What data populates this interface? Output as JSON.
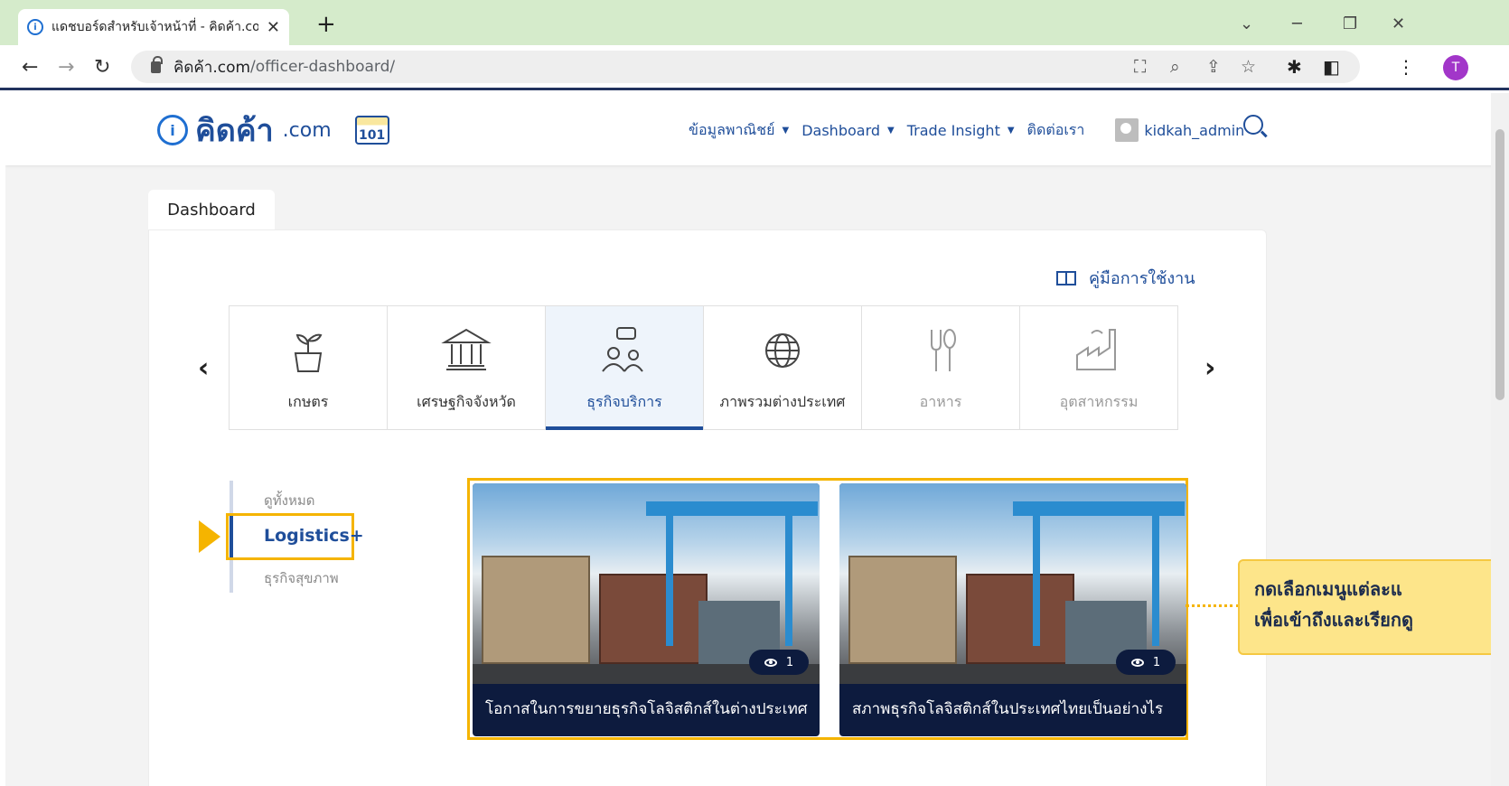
{
  "browser": {
    "tab_title": "แดชบอร์ดสำหรับเจ้าหน้าที่ - คิดค้า.com",
    "url_domain": "คิดค้า.com",
    "url_path": "/officer-dashboard/",
    "profile_initial": "T"
  },
  "site": {
    "logo_text": "คิดค้า",
    "logo_suffix": ".com",
    "seal_text": "101",
    "nav": [
      {
        "label": "ข้อมูลพาณิชย์",
        "has_dropdown": true
      },
      {
        "label": "Dashboard",
        "has_dropdown": true
      },
      {
        "label": "Trade Insight",
        "has_dropdown": true
      },
      {
        "label": "ติดต่อเรา",
        "has_dropdown": false
      }
    ],
    "username": "kidkah_admin"
  },
  "dashboard": {
    "tab_label": "Dashboard",
    "manual_label": "คู่มือการใช้งาน",
    "categories": [
      {
        "label": "เกษตร",
        "icon": "plant-icon"
      },
      {
        "label": "เศรษฐกิจจังหวัด",
        "icon": "government-building-icon"
      },
      {
        "label": "ธุรกิจบริการ",
        "icon": "people-chat-icon",
        "active": true
      },
      {
        "label": "ภาพรวมต่างประเทศ",
        "icon": "globe-icon"
      },
      {
        "label": "อาหาร",
        "icon": "fork-spoon-icon",
        "dim": true
      },
      {
        "label": "อุตสาหกรรม",
        "icon": "factory-icon",
        "dim": true
      }
    ],
    "subnav": {
      "items": [
        "ดูทั้งหมด",
        "Logistics+",
        "ธุรกิจสุขภาพ"
      ],
      "active": "Logistics+"
    },
    "cards": [
      {
        "title": "โอกาสในการขยายธุรกิจโลจิสติกส์ในต่างประเทศ",
        "views": "1"
      },
      {
        "title": "สภาพธุรกิจโลจิสติกส์ในประเทศไทยเป็นอย่างไร",
        "views": "1"
      }
    ],
    "callout": {
      "line1": "กดเลือกเมนูแต่ละแ",
      "line2": "เพื่อเข้าถึงและเรียกดู"
    }
  },
  "colors": {
    "brand_navy": "#1f4e9a",
    "highlight": "#f5b400",
    "tabbar_green": "#d5ebcb"
  }
}
